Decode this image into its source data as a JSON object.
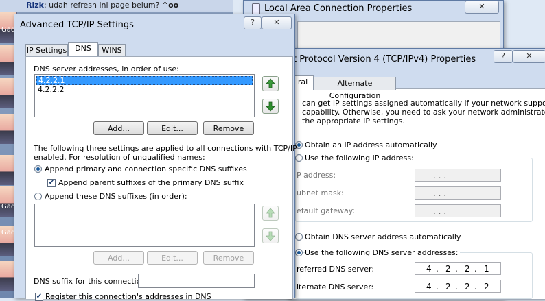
{
  "chat": {
    "top_line_name": "Rizk",
    "top_line_text": ": udah refresh ini page belum?",
    "top_line_emote": "^oo",
    "gad_labels": [
      "Gad",
      "Gad",
      "Gad"
    ]
  },
  "lac_window": {
    "title": "Local Area Connection Properties",
    "help": "?",
    "close": "✕"
  },
  "ipv4_window": {
    "title": "t Protocol Version 4 (TCP/IPv4) Properties",
    "help": "?",
    "close": "✕",
    "tabs": [
      "ral",
      "Alternate Configuration"
    ],
    "intro_lines": [
      "can get IP settings assigned automatically if your network supports",
      "capability. Otherwise, you need to ask your network administrator",
      "the appropriate IP settings."
    ],
    "obtain_ip_auto": "Obtain an IP address automatically",
    "use_following_ip": "Use the following IP address:",
    "ip_address_label": "P address:",
    "subnet_label": "ubnet mask:",
    "gateway_label": "efault gateway:",
    "ip_placeholder": ".   .   .",
    "obtain_dns_auto": "Obtain DNS server address automatically",
    "use_following_dns": "Use the following DNS server addresses:",
    "preferred_dns_label": "referred DNS server:",
    "alternate_dns_label": "lternate DNS server:",
    "preferred_dns_octets": [
      "4",
      "2",
      "2",
      "1"
    ],
    "alternate_dns_octets": [
      "4",
      "2",
      "2",
      "2"
    ]
  },
  "adv_window": {
    "title": "Advanced TCP/IP Settings",
    "help": "?",
    "close": "✕",
    "tabs": [
      "IP Settings",
      "DNS",
      "WINS"
    ],
    "active_tab": "DNS",
    "dns_list_label": "DNS server addresses, in order of use:",
    "dns_servers": [
      "4.2.2.1",
      "4.2.2.2"
    ],
    "add_label": "Add...",
    "edit_label": "Edit...",
    "remove_label": "Remove",
    "info_line1": "The following three settings are applied to all connections with TCP/IP",
    "info_line2": "enabled. For resolution of unqualified names:",
    "append_primary": "Append primary and connection specific DNS suffixes",
    "append_parent": "Append parent suffixes of the primary DNS suffix",
    "append_these": "Append these DNS suffixes (in order):",
    "suffix_label": "DNS suffix for this connection:",
    "register_label": "Register this connection's addresses in DNS"
  },
  "colors": {
    "selection": "#3399ff",
    "up_arrow": "#3b9a3b",
    "down_arrow": "#2f8f2f"
  },
  "icons": {
    "arrow_up": "green-up-arrow-icon",
    "arrow_down": "green-down-arrow-icon"
  }
}
